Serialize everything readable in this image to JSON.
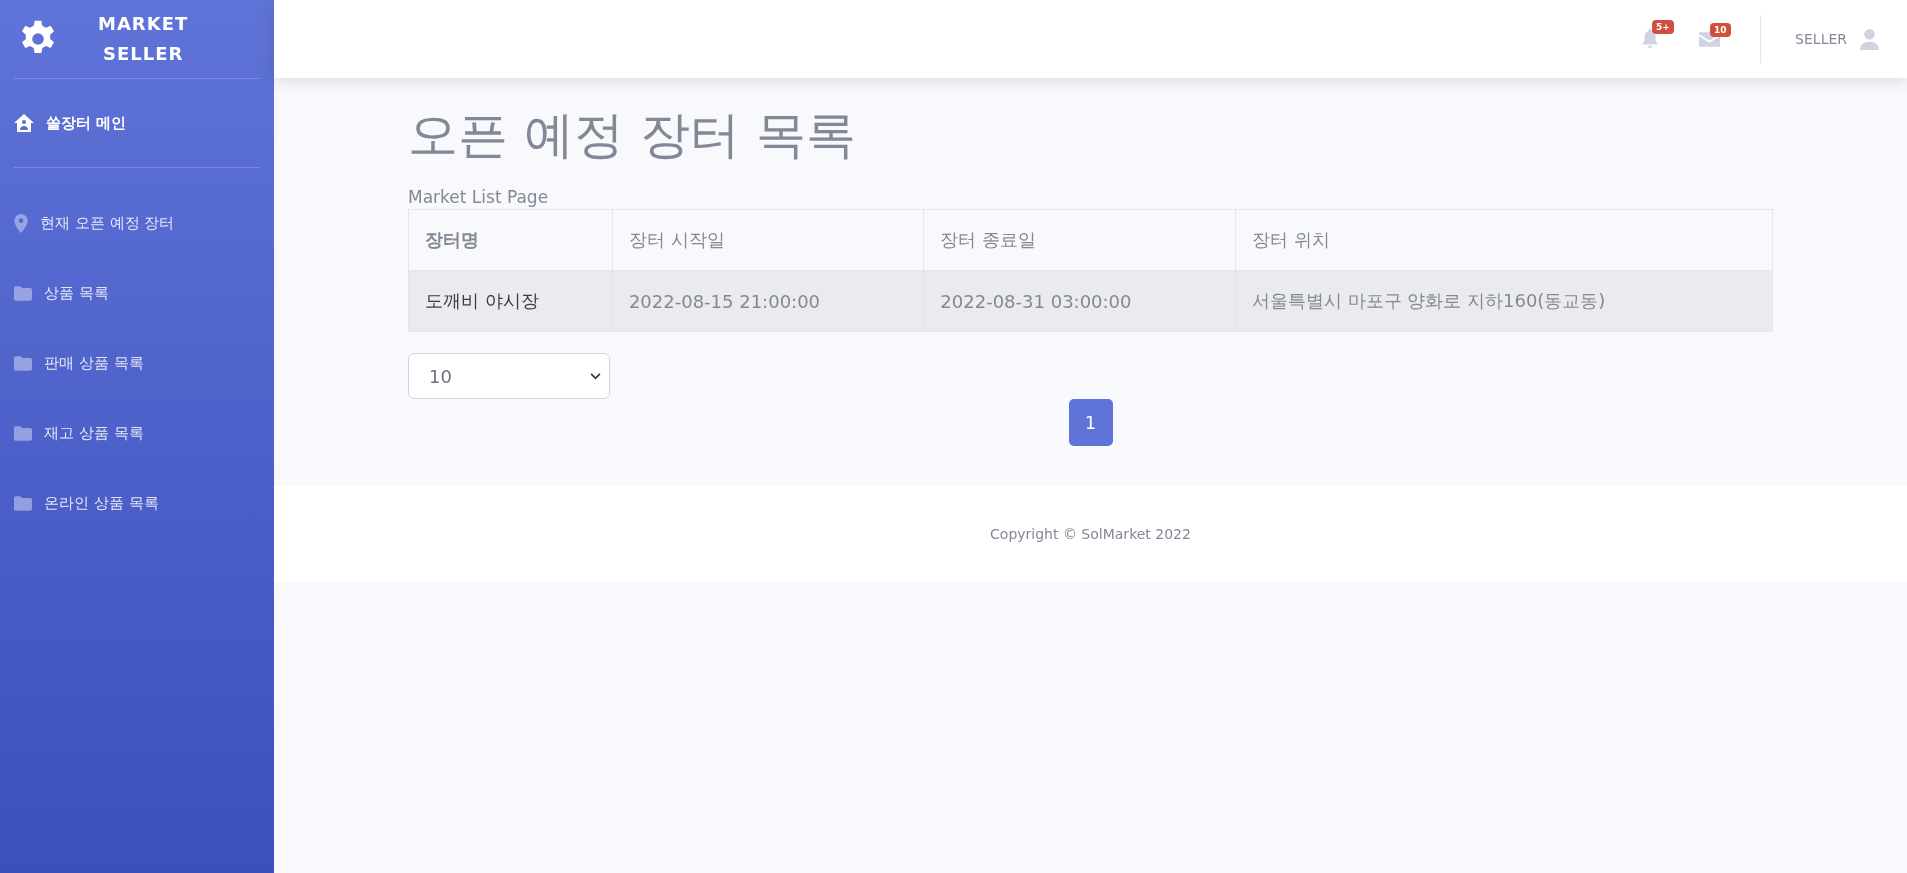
{
  "sidebar": {
    "brand": [
      "MARKET",
      "SELLER"
    ],
    "items": [
      {
        "label": "쏠장터 메인",
        "kind": "home",
        "selected": true
      },
      {
        "label": "현재 오픈 예정 장터",
        "kind": "pin",
        "selected": false
      },
      {
        "label": "상품 목록",
        "kind": "folder",
        "selected": false
      },
      {
        "label": "판매 상품 목록",
        "kind": "folder",
        "selected": false
      },
      {
        "label": "재고 상품 목록",
        "kind": "folder",
        "selected": false
      },
      {
        "label": "온라인 상품 목록",
        "kind": "folder",
        "selected": false
      }
    ]
  },
  "topbar": {
    "alerts_badge": "5+",
    "messages_badge": "10",
    "user": "SELLER"
  },
  "page": {
    "title": "오픈 예정 장터 목록",
    "subtitle": "Market List Page"
  },
  "table": {
    "columns": [
      "장터명",
      "장터 시작일",
      "장터 종료일",
      "장터 위치"
    ],
    "rows": [
      [
        "도깨비 야시장",
        "2022-08-15 21:00:00",
        "2022-08-31 03:00:00",
        "서울특별시 마포구 양화로 지하160(동교동)"
      ]
    ]
  },
  "page_size": "10",
  "pagination": [
    {
      "label": "1",
      "selected": true
    }
  ],
  "footer": "Copyright © SolMarket 2022"
}
